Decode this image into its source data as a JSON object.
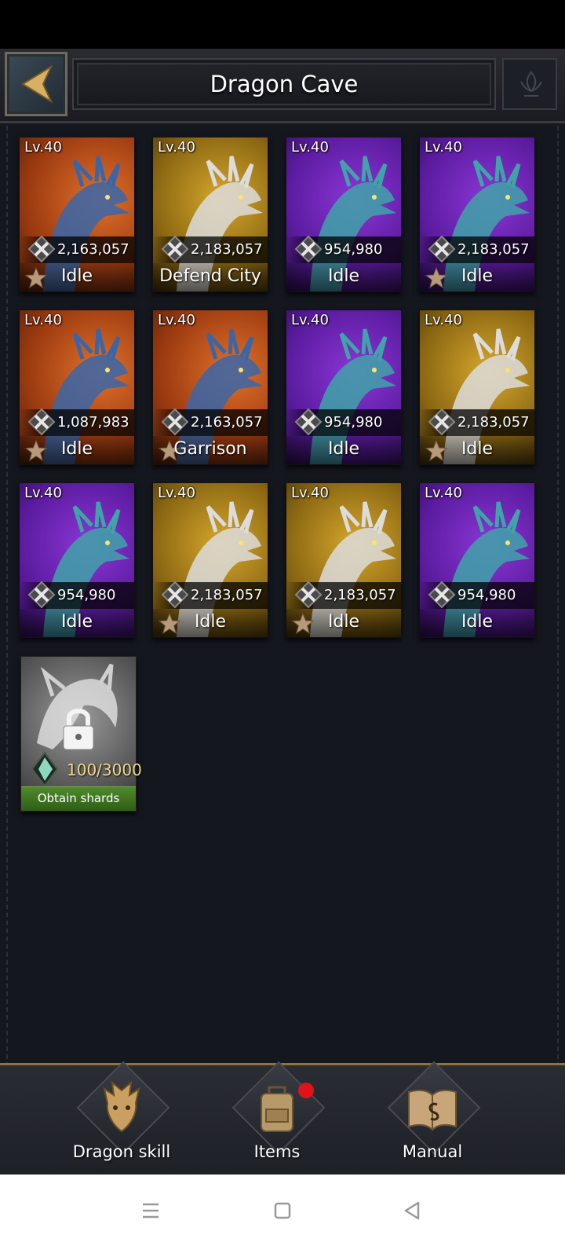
{
  "header": {
    "title": "Dragon Cave"
  },
  "dragons": [
    {
      "level": "Lv.40",
      "power": "2,163,057",
      "status": "Idle",
      "bg": "orange",
      "star": true
    },
    {
      "level": "Lv.40",
      "power": "2,183,057",
      "status": "Defend City",
      "bg": "gold",
      "star": false
    },
    {
      "level": "Lv.40",
      "power": "954,980",
      "status": "Idle",
      "bg": "purple",
      "star": false
    },
    {
      "level": "Lv.40",
      "power": "2,183,057",
      "status": "Idle",
      "bg": "purple",
      "star": true
    },
    {
      "level": "Lv.40",
      "power": "1,087,983",
      "status": "Idle",
      "bg": "orange",
      "star": true
    },
    {
      "level": "Lv.40",
      "power": "2,163,057",
      "status": "Garrison",
      "bg": "orange",
      "star": true
    },
    {
      "level": "Lv.40",
      "power": "954,980",
      "status": "Idle",
      "bg": "purple",
      "star": false
    },
    {
      "level": "Lv.40",
      "power": "2,183,057",
      "status": "Idle",
      "bg": "gold",
      "star": true
    },
    {
      "level": "Lv.40",
      "power": "954,980",
      "status": "Idle",
      "bg": "purple",
      "star": false
    },
    {
      "level": "Lv.40",
      "power": "2,183,057",
      "status": "Idle",
      "bg": "gold",
      "star": true
    },
    {
      "level": "Lv.40",
      "power": "2,183,057",
      "status": "Idle",
      "bg": "gold",
      "star": true
    },
    {
      "level": "Lv.40",
      "power": "954,980",
      "status": "Idle",
      "bg": "purple",
      "star": false
    }
  ],
  "locked": {
    "shards": "100/3000",
    "button_label": "Obtain shards"
  },
  "bottom_nav": [
    {
      "label": "Dragon skill",
      "icon": "dragon-head-icon"
    },
    {
      "label": "Items",
      "icon": "backpack-icon",
      "badge": true
    },
    {
      "label": "Manual",
      "icon": "book-icon"
    }
  ],
  "colors": {
    "accent": "#8a7540",
    "badge": "#e0121a",
    "obtain_green": "#4f8a2b"
  }
}
